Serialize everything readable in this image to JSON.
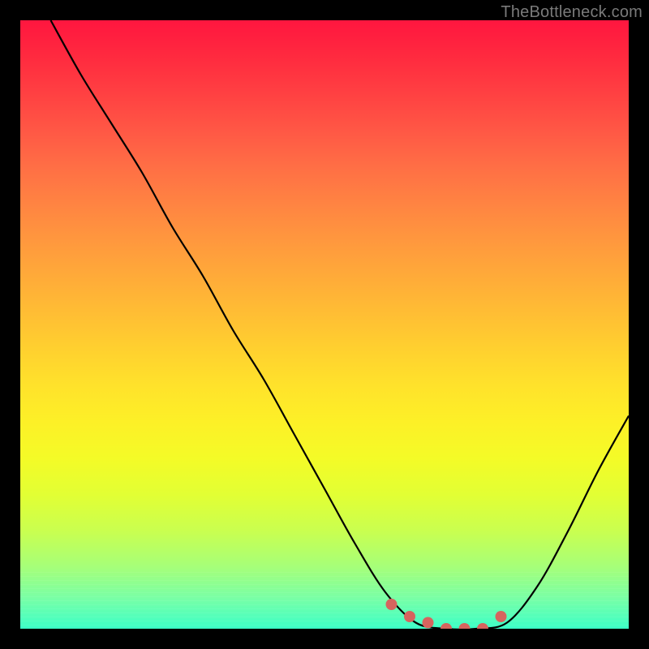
{
  "watermark": "TheBottleneck.com",
  "colors": {
    "curve_stroke": "#000000",
    "marker_fill": "#d6645e",
    "background_border": "#000000"
  },
  "chart_data": {
    "type": "line",
    "title": "",
    "xlabel": "",
    "ylabel": "",
    "xlim": [
      0,
      100
    ],
    "ylim": [
      0,
      100
    ],
    "grid": false,
    "series": [
      {
        "name": "bottleneck-curve",
        "x": [
          5,
          10,
          15,
          20,
          25,
          30,
          35,
          40,
          45,
          50,
          55,
          60,
          65,
          70,
          75,
          80,
          85,
          90,
          95,
          100
        ],
        "y": [
          100,
          91,
          83,
          75,
          66,
          58,
          49,
          41,
          32,
          23,
          14,
          6,
          1,
          0,
          0,
          1,
          7,
          16,
          26,
          35
        ]
      }
    ],
    "markers": {
      "name": "highlight-segment",
      "x": [
        61,
        64,
        67,
        70,
        73,
        76,
        79
      ],
      "y": [
        4,
        2,
        1,
        0,
        0,
        0,
        2
      ]
    }
  }
}
